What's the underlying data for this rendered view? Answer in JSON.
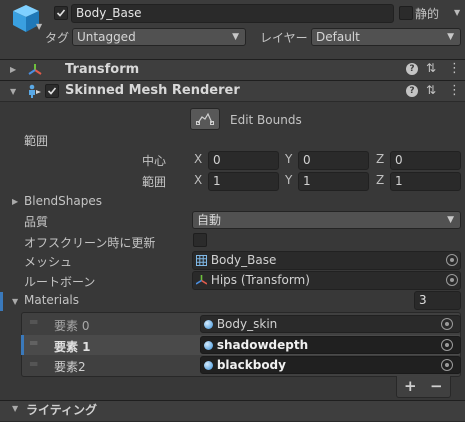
{
  "gameobject": {
    "name": "Body_Base",
    "static_label": "静的",
    "tag_label": "タグ",
    "tag_value": "Untagged",
    "layer_label": "レイヤー",
    "layer_value": "Default"
  },
  "transform": {
    "title": "Transform"
  },
  "smr": {
    "title": "Skinned Mesh Renderer",
    "edit_bounds": "Edit Bounds",
    "bounds_label": "範囲",
    "center_label": "中心",
    "extent_label": "範囲",
    "axis_x": "X",
    "axis_y": "Y",
    "axis_z": "Z",
    "center": {
      "x": "0",
      "y": "0",
      "z": "0"
    },
    "extent": {
      "x": "1",
      "y": "1",
      "z": "1"
    },
    "blendshapes_label": "BlendShapes",
    "quality_label": "品質",
    "quality_value": "自動",
    "offscreen_label": "オフスクリーン時に更新",
    "mesh_label": "メッシュ",
    "mesh_value": "Body_Base",
    "rootbone_label": "ルートボーン",
    "rootbone_value": "Hips (Transform)"
  },
  "materials": {
    "label": "Materials",
    "count": "3",
    "items": [
      {
        "label": "要素 0",
        "value": "Body_skin"
      },
      {
        "label": "要素 1",
        "value": "shadowdepth"
      },
      {
        "label": "要素2",
        "value": "blackbody"
      }
    ],
    "add": "+",
    "remove": "−"
  },
  "next_section": {
    "title": "ライティング"
  }
}
